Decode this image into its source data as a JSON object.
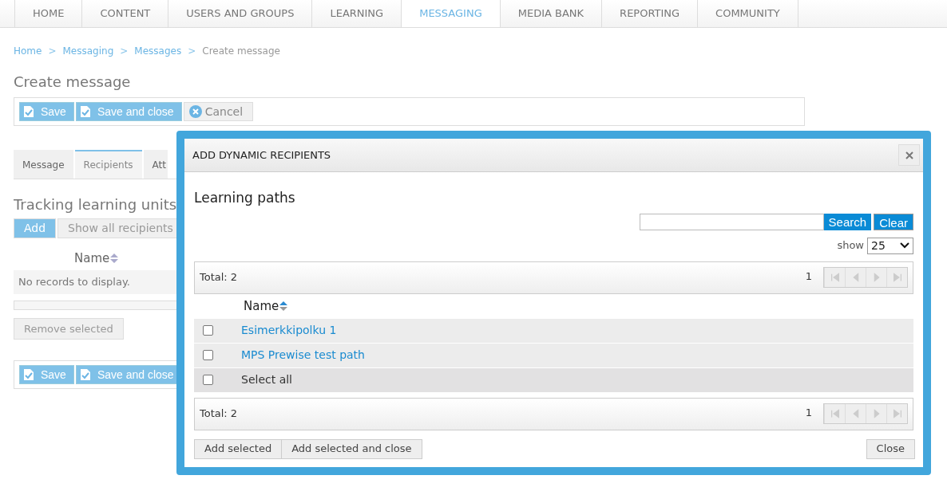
{
  "nav": [
    {
      "label": "HOME",
      "selected": false
    },
    {
      "label": "CONTENT",
      "selected": false
    },
    {
      "label": "USERS AND GROUPS",
      "selected": false
    },
    {
      "label": "LEARNING",
      "selected": false
    },
    {
      "label": "MESSAGING",
      "selected": true
    },
    {
      "label": "MEDIA BANK",
      "selected": false
    },
    {
      "label": "REPORTING",
      "selected": false
    },
    {
      "label": "COMMUNITY",
      "selected": false
    }
  ],
  "breadcrumb_separator": ">",
  "breadcrumb": [
    {
      "label": "Home",
      "kind": "link"
    },
    {
      "label": "Messaging",
      "kind": "link"
    },
    {
      "label": "Messages",
      "kind": "link"
    },
    {
      "label": "Create message",
      "kind": "current"
    }
  ],
  "page_title": "Create message",
  "toolbar": [
    {
      "label": "Save",
      "kind": "save"
    },
    {
      "label": "Save and close",
      "kind": "save"
    },
    {
      "label": "Cancel",
      "kind": "cancel"
    }
  ],
  "tabs": [
    {
      "label": "Message",
      "selected": false
    },
    {
      "label": "Recipients",
      "selected": true
    },
    {
      "label": "Att",
      "selected": false
    }
  ],
  "section": {
    "title": "Tracking learning units",
    "buttons": [
      {
        "label": "Add",
        "kind": "primary"
      },
      {
        "label": "Show all recipients",
        "kind": "secondary"
      }
    ],
    "column": "Name",
    "empty": "No records to display.",
    "remove_button": "Remove selected"
  },
  "bottom_toolbar": [
    {
      "label": "Save",
      "kind": "save"
    },
    {
      "label": "Save and close",
      "kind": "save"
    }
  ],
  "dialog": {
    "title": "ADD DYNAMIC RECIPIENTS",
    "heading": "Learning paths",
    "search_button": "Search",
    "clear_button": "Clear",
    "show_label": "show",
    "show_value": "25",
    "top_pager": {
      "total": "Total: 2",
      "page": "1"
    },
    "column": "Name",
    "rows": [
      {
        "label": "Esimerkkipolku 1",
        "checked": false
      },
      {
        "label": "MPS Prewise test path",
        "checked": false
      }
    ],
    "select_all": {
      "label": "Select all",
      "checked": false
    },
    "bottom_pager": {
      "total": "Total: 2",
      "page": "1"
    },
    "buttons": [
      "Add selected",
      "Add selected and close"
    ],
    "close_button": "Close"
  }
}
